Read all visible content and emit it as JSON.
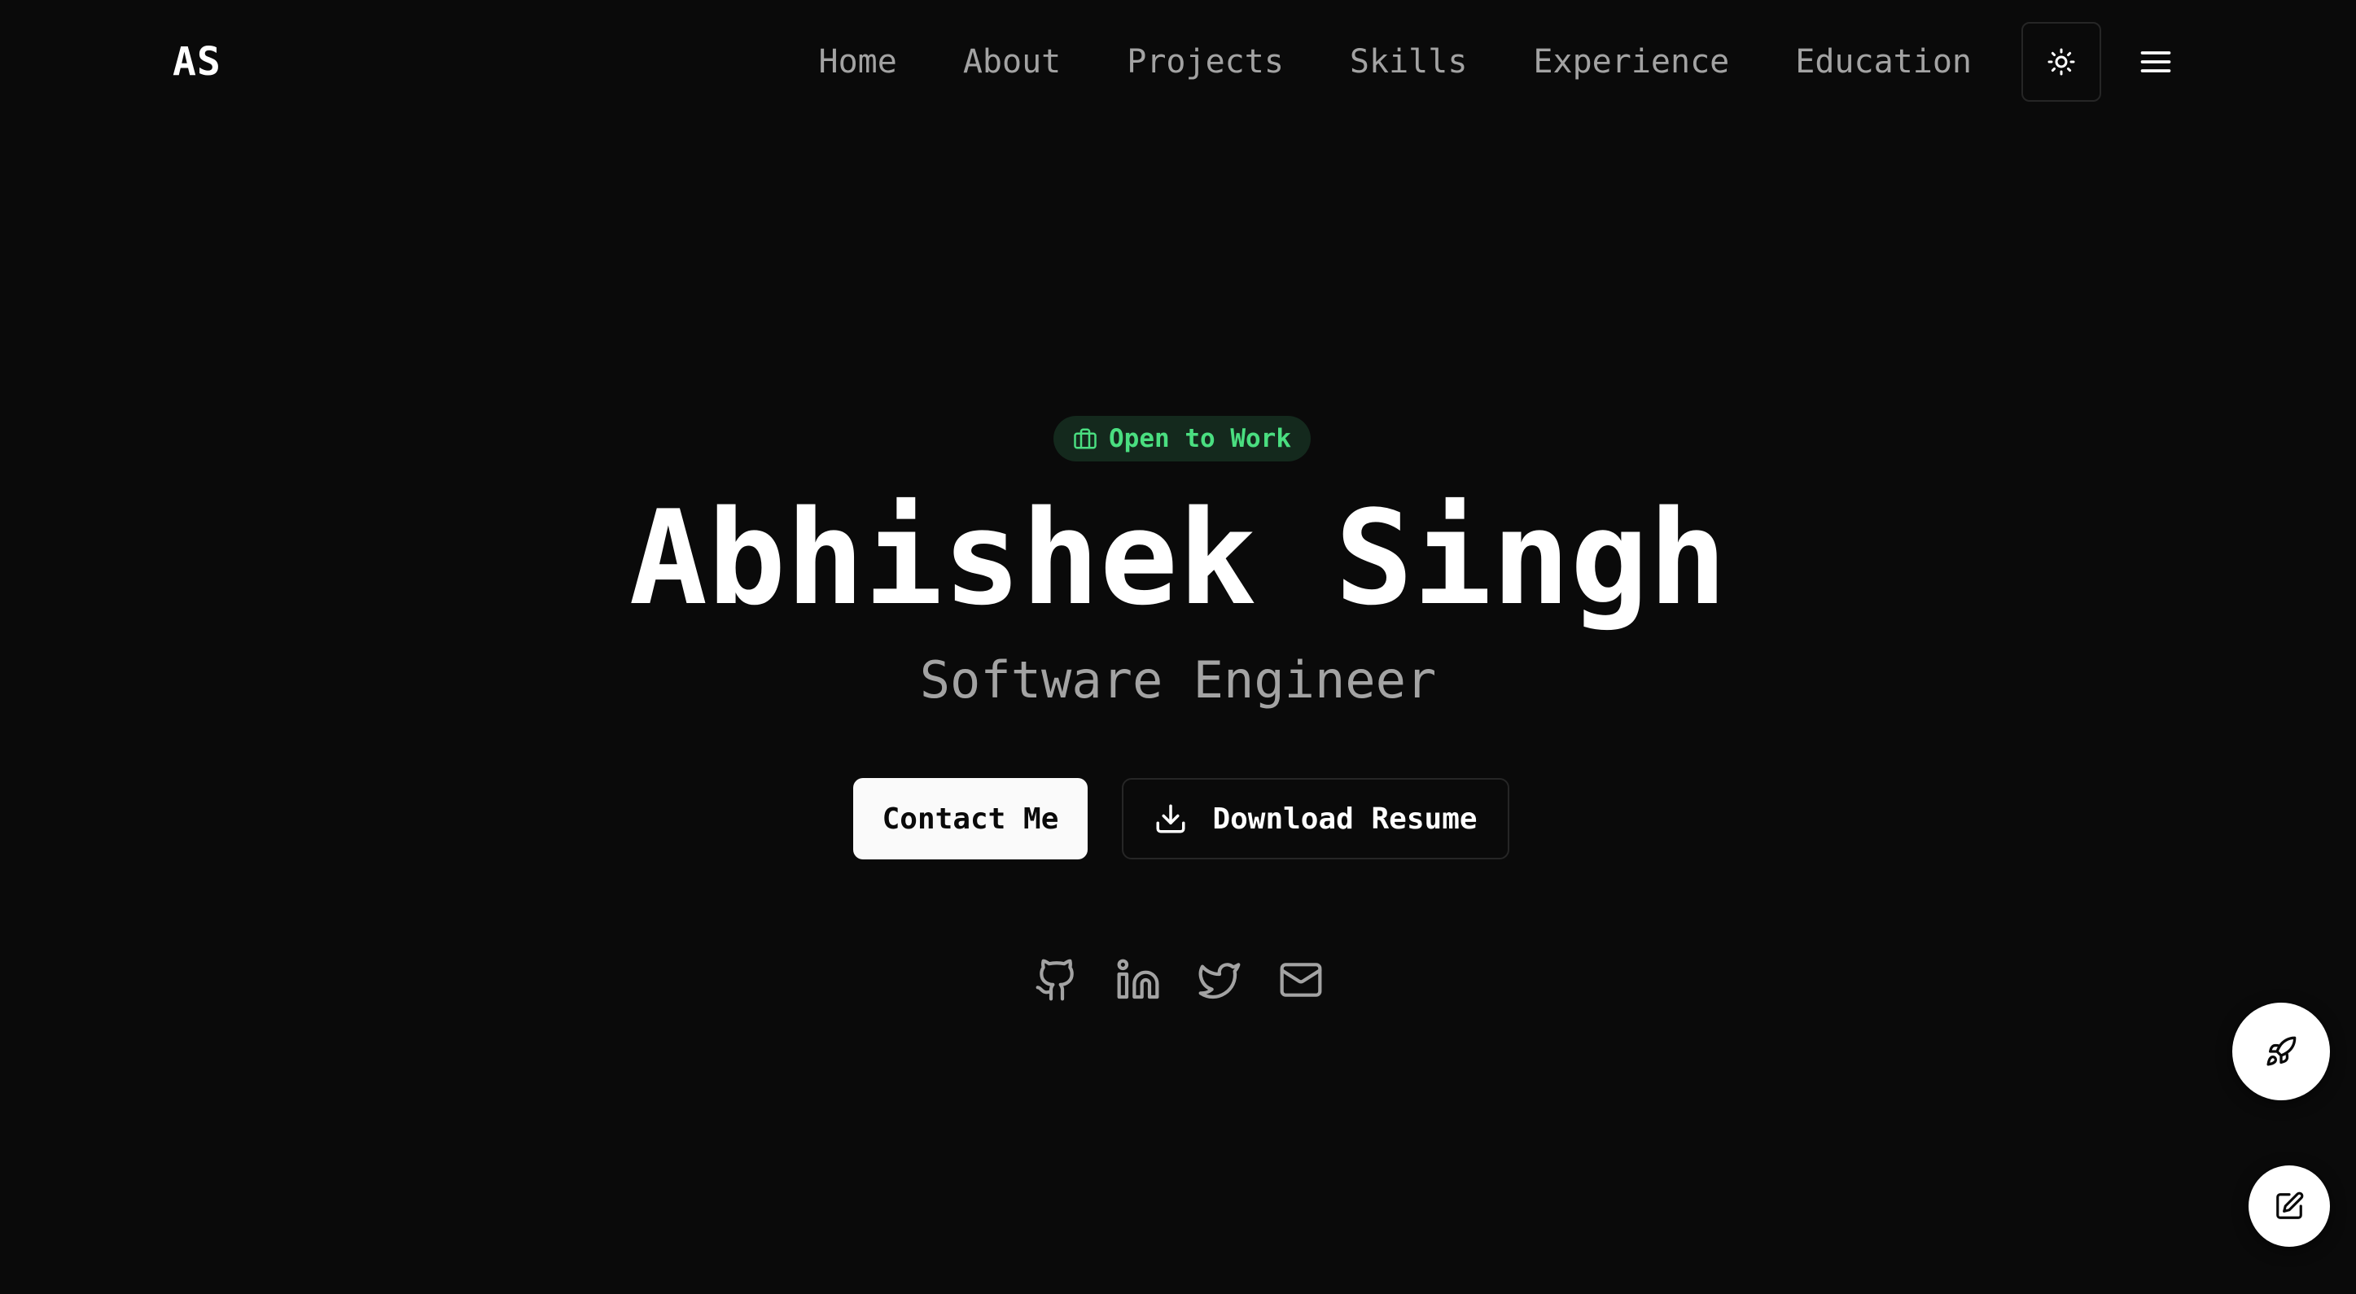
{
  "brand": {
    "logo": "AS"
  },
  "nav": {
    "links": [
      "Home",
      "About",
      "Projects",
      "Skills",
      "Experience",
      "Education"
    ],
    "theme_toggle_icon": "sun-icon",
    "menu_icon": "menu-icon"
  },
  "hero": {
    "badge": {
      "label": "Open to Work",
      "icon": "briefcase-icon",
      "color": "#4ade80"
    },
    "name": "Abhishek Singh",
    "role": "Software Engineer",
    "buttons": {
      "contact": "Contact Me",
      "resume": "Download Resume",
      "resume_icon": "download-icon"
    },
    "socials": [
      "github-icon",
      "linkedin-icon",
      "twitter-icon",
      "mail-icon"
    ]
  },
  "floating": {
    "primary_icon": "rocket-icon",
    "secondary_icon": "edit-icon"
  },
  "colors": {
    "background": "#0a0a0a",
    "text": "#ffffff",
    "muted": "#a3a3a3",
    "accent": "#4ade80",
    "border": "#262626"
  }
}
